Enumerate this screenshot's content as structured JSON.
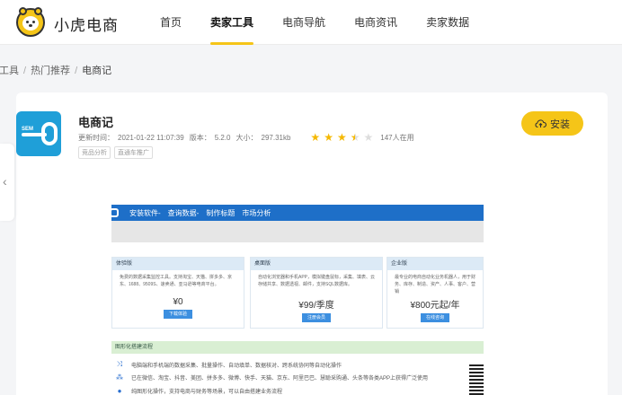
{
  "header": {
    "brand": "小虎电商",
    "nav": [
      {
        "label": "首页",
        "active": false
      },
      {
        "label": "卖家工具",
        "active": true
      },
      {
        "label": "电商导航",
        "active": false
      },
      {
        "label": "电商资讯",
        "active": false
      },
      {
        "label": "卖家数据",
        "active": false
      }
    ]
  },
  "breadcrumb": {
    "items": [
      "家工具",
      "热门推荐",
      "电商记"
    ],
    "separator": "/"
  },
  "app": {
    "title": "电商记",
    "icon_text": "SEM",
    "updated_label": "更新时间：",
    "updated_value": "2021-01-22 11:07:39",
    "version_label": "版本：",
    "version_value": "5.2.0",
    "size_label": "大小：",
    "size_value": "297.31kb",
    "rating": 3.5,
    "users": "147人在用",
    "tags": [
      "竞品分析",
      "直通车推广"
    ],
    "install_label": "安装",
    "accent_color": "#f5c518"
  },
  "preview": {
    "nav": [
      "安装软件-",
      "查询数据-",
      "制作标题",
      "市场分析"
    ],
    "plans": [
      {
        "name": "体验版",
        "desc": "免费的数据采集监控工具。支持淘宝、天猫、拼多多、京东、1688、9509S、速卖通、亚马逊等电商平台。",
        "price": "¥0",
        "button": "下载体验"
      },
      {
        "name": "桌面版",
        "desc": "自动化浏览器和手机APP，模拟键盘鼠标，采集、填表、云存储共享、数据透视、邮件，支持SQL数据库。",
        "price": "¥99/季度",
        "button": "注册会员"
      },
      {
        "name": "企业版",
        "desc": "最专业的电商自动化业务机器人，用于财务、库存、制造、资产、人事、客户、营销",
        "price": "¥800元起/年",
        "button": "在线咨询"
      }
    ],
    "flow_title": "图形化搭建流程",
    "features": [
      "电脑端和手机端的数据采集、批量操作、自动填单、数据核对、跨系统协同等自动化操作",
      "已在微信、淘宝、抖音、美团、拼多多、微博、快手、天猫、京东、阿里巴巴、慧聪采购通、头条等各类APP上获得广泛使用",
      "纯图形化操作，支持电商与财务等场景，可以自由搭建业务流程"
    ]
  }
}
